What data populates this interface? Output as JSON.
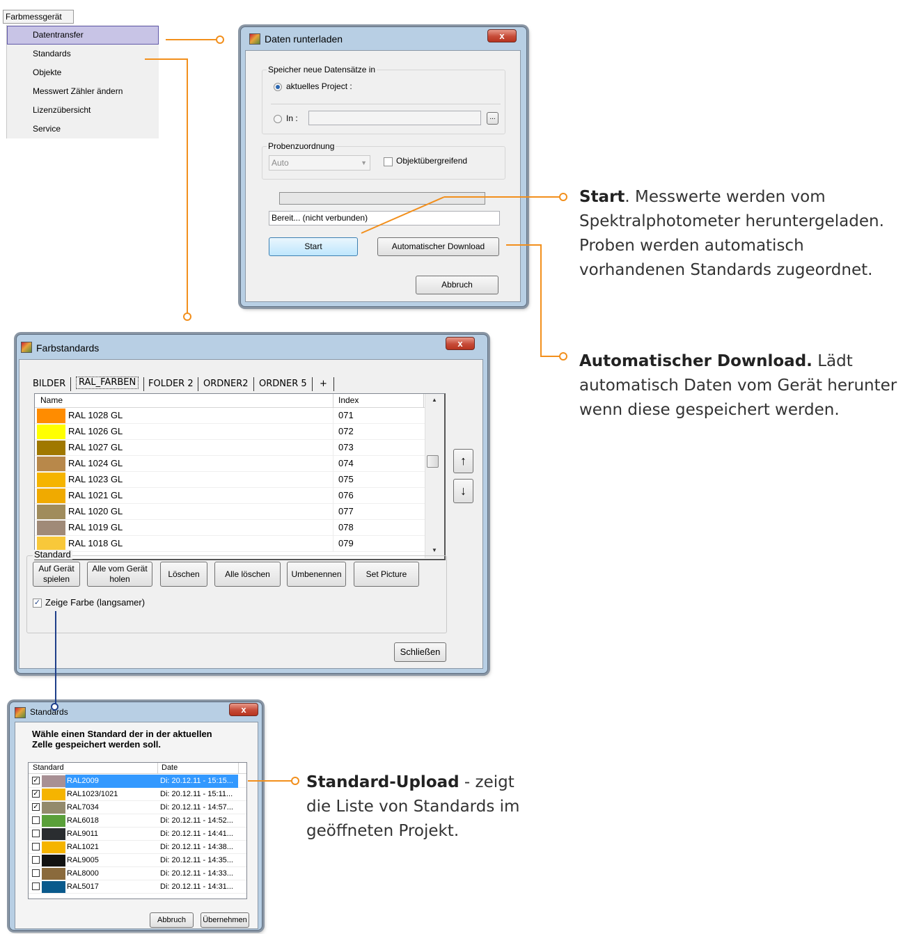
{
  "menu": {
    "header": "Farbmessgerät",
    "items": [
      "Datentransfer",
      "Standards",
      "Objekte",
      "Messwert Zähler ändern",
      "Lizenzübersicht",
      "Service"
    ]
  },
  "download_dialog": {
    "title": "Daten runterladen",
    "close": "x",
    "group_store": "Speicher neue Datensätze in",
    "radio_current": "aktuelles Project :",
    "radio_in": "In :",
    "browse": "...",
    "group_assign": "Probenzuordnung",
    "assign_value": "Auto",
    "cross_object": "Objektübergreifend",
    "status": "Bereit... (nicht verbunden)",
    "start": "Start",
    "auto_download": "Automatischer Download",
    "cancel": "Abbruch"
  },
  "standards_window": {
    "title": "Farbstandards",
    "close": "x",
    "tabs": [
      "BILDER",
      "RAL_FARBEN",
      "FOLDER 2",
      "ORDNER2",
      "ORDNER 5",
      "+"
    ],
    "active_tab": "RAL_FARBEN",
    "col_name": "Name",
    "col_index": "Index",
    "rows": [
      {
        "name": "RAL 1028 GL",
        "index": "071",
        "color": "#ff8c00"
      },
      {
        "name": "RAL 1026 GL",
        "index": "072",
        "color": "#ffff00"
      },
      {
        "name": "RAL 1027 GL",
        "index": "073",
        "color": "#a07800"
      },
      {
        "name": "RAL 1024 GL",
        "index": "074",
        "color": "#b8884a"
      },
      {
        "name": "RAL 1023 GL",
        "index": "075",
        "color": "#f5b400"
      },
      {
        "name": "RAL 1021 GL",
        "index": "076",
        "color": "#f0aa00"
      },
      {
        "name": "RAL 1020 GL",
        "index": "077",
        "color": "#a08c5c"
      },
      {
        "name": "RAL 1019 GL",
        "index": "078",
        "color": "#a08a78"
      },
      {
        "name": "RAL 1018 GL",
        "index": "079",
        "color": "#f8c83a"
      }
    ],
    "up": "↑",
    "down": "↓",
    "group_standard": "Standard",
    "btn_play_1": "Auf Gerät",
    "btn_play_2": "spielen",
    "btn_fetch_1": "Alle vom Gerät",
    "btn_fetch_2": "holen",
    "btn_delete": "Löschen",
    "btn_delete_all": "Alle löschen",
    "btn_rename": "Umbenennen",
    "btn_picture": "Set Picture",
    "show_color": "Zeige Farbe (langsamer)",
    "close_btn": "Schließen"
  },
  "upload_dialog": {
    "title": "Standards",
    "close": "x",
    "prompt_1": "Wähle einen Standard der in der aktuellen",
    "prompt_2": "Zelle gespeichert werden soll.",
    "col_standard": "Standard",
    "col_date": "Date",
    "rows": [
      {
        "name": "RAL2009",
        "date": "Di: 20.12.11 - 15:15...",
        "color": "#a89094",
        "checked": true,
        "selected": true
      },
      {
        "name": "RAL1023/1021",
        "date": "Di: 20.12.11 - 15:11...",
        "color": "#f5b400",
        "checked": true,
        "selected": false
      },
      {
        "name": "RAL7034",
        "date": "Di: 20.12.11 - 14:57...",
        "color": "#938a6c",
        "checked": true,
        "selected": false
      },
      {
        "name": "RAL6018",
        "date": "Di: 20.12.11 - 14:52...",
        "color": "#5aa03a",
        "checked": false,
        "selected": false
      },
      {
        "name": "RAL9011",
        "date": "Di: 20.12.11 - 14:41...",
        "color": "#2a2d30",
        "checked": false,
        "selected": false
      },
      {
        "name": "RAL1021",
        "date": "Di: 20.12.11 - 14:38...",
        "color": "#f5b400",
        "checked": false,
        "selected": false
      },
      {
        "name": "RAL9005",
        "date": "Di: 20.12.11 - 14:35...",
        "color": "#121212",
        "checked": false,
        "selected": false
      },
      {
        "name": "RAL8000",
        "date": "Di: 20.12.11 - 14:33...",
        "color": "#8a6a3c",
        "checked": false,
        "selected": false
      },
      {
        "name": "RAL5017",
        "date": "Di: 20.12.11 - 14:31...",
        "color": "#0a5a8c",
        "checked": false,
        "selected": false
      }
    ],
    "cancel": "Abbruch",
    "apply": "Übernehmen"
  },
  "callouts": {
    "start_bold": "Start",
    "start_text": ". Messwerte werden vom Spektralphotometer heruntergeladen. Proben werden automatisch vorhandenen Standards zugeordnet.",
    "auto_bold": "Automatischer Download.",
    "auto_text": " Lädt automatisch Daten vom Gerät herunter wenn diese gespeichert werden.",
    "upload_bold": "Standard-Upload",
    "upload_text": " - zeigt die Liste von Standards im geöffneten Projekt."
  },
  "colors": {
    "accent_orange": "#f28f1c",
    "connector_blue": "#1f3f8a",
    "selection_blue": "#3399ff"
  }
}
